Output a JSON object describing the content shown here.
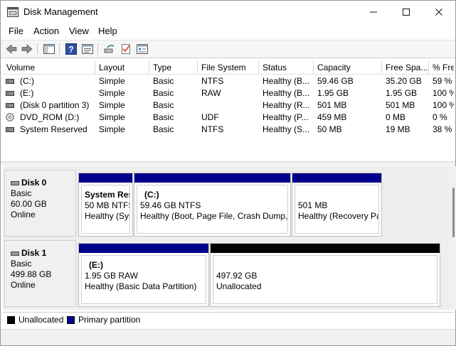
{
  "window": {
    "title": "Disk Management",
    "minimize": "—",
    "maximize": "☐",
    "close": "✕"
  },
  "menu": [
    "File",
    "Action",
    "View",
    "Help"
  ],
  "toolbar": {
    "icons": [
      "back-arrow-icon",
      "forward-arrow-icon",
      "console-tree-icon",
      "help-icon",
      "properties-list-icon",
      "refresh-disk-icon",
      "checklist-icon",
      "settings-panel-icon"
    ]
  },
  "volumes": {
    "columns": [
      "Volume",
      "Layout",
      "Type",
      "File System",
      "Status",
      "Capacity",
      "Free Spa...",
      "% Fre"
    ],
    "rows": [
      {
        "volume": "(C:)",
        "layout": "Simple",
        "type": "Basic",
        "fs": "NTFS",
        "status": "Healthy (B...",
        "capacity": "59.46 GB",
        "free": "35.20 GB",
        "pct": "59 %",
        "icon": "disk"
      },
      {
        "volume": "(E:)",
        "layout": "Simple",
        "type": "Basic",
        "fs": "RAW",
        "status": "Healthy (B...",
        "capacity": "1.95 GB",
        "free": "1.95 GB",
        "pct": "100 %",
        "icon": "disk"
      },
      {
        "volume": "(Disk 0 partition 3)",
        "layout": "Simple",
        "type": "Basic",
        "fs": "",
        "status": "Healthy (R...",
        "capacity": "501 MB",
        "free": "501 MB",
        "pct": "100 %",
        "icon": "disk"
      },
      {
        "volume": "DVD_ROM (D:)",
        "layout": "Simple",
        "type": "Basic",
        "fs": "UDF",
        "status": "Healthy (P...",
        "capacity": "459 MB",
        "free": "0 MB",
        "pct": "0 %",
        "icon": "dvd"
      },
      {
        "volume": "System Reserved",
        "layout": "Simple",
        "type": "Basic",
        "fs": "NTFS",
        "status": "Healthy (S...",
        "capacity": "50 MB",
        "free": "19 MB",
        "pct": "38 %",
        "icon": "disk"
      }
    ]
  },
  "disks": [
    {
      "name": "Disk 0",
      "type": "Basic",
      "size": "60.00 GB",
      "state": "Online",
      "partitions": [
        {
          "title": "System Res",
          "line1": "50 MB NTFS",
          "line2": "Healthy (Sys",
          "kind": "primary"
        },
        {
          "title": "(C:)",
          "line1": "59.46 GB NTFS",
          "line2": "Healthy (Boot, Page File, Crash Dump, I",
          "kind": "primary"
        },
        {
          "title": "",
          "line1": "501 MB",
          "line2": "Healthy (Recovery Pa",
          "kind": "primary"
        }
      ]
    },
    {
      "name": "Disk 1",
      "type": "Basic",
      "size": "499.88 GB",
      "state": "Online",
      "partitions": [
        {
          "title": "(E:)",
          "line1": "1.95 GB RAW",
          "line2": "Healthy (Basic Data Partition)",
          "kind": "primary"
        },
        {
          "title": "",
          "line1": "497.92 GB",
          "line2": "Unallocated",
          "kind": "unallocated"
        }
      ]
    }
  ],
  "legend": [
    {
      "label": "Unallocated",
      "color": "#000000"
    },
    {
      "label": "Primary partition",
      "color": "#00008b"
    }
  ],
  "colors": {
    "primary": "#00008b",
    "unallocated": "#000000"
  }
}
